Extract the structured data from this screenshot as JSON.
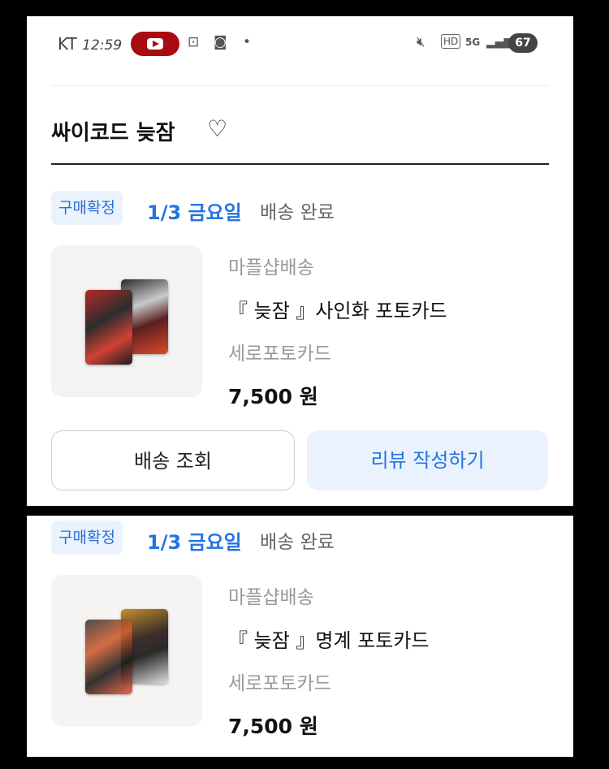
{
  "status_bar": {
    "carrier": "KT",
    "time": "12:59",
    "battery": "67",
    "network_hd": "HD",
    "network_5g": "5G"
  },
  "shop": {
    "name": "싸이코드 늦잠"
  },
  "orders": [
    {
      "badge": "구매확정",
      "date": "1/3 금요일",
      "delivery_status": "배송 완료",
      "seller": "마플샵배송",
      "product_name": "『 늦잠 』사인화 포토카드",
      "option": "세로포토카드",
      "price": "7,500 원",
      "buttons": {
        "track": "배송 조회",
        "review": "리뷰 작성하기"
      }
    },
    {
      "badge": "구매확정",
      "date": "1/3 금요일",
      "delivery_status": "배송 완료",
      "seller": "마플샵배송",
      "product_name": "『 늦잠 』명계 포토카드",
      "option": "세로포토카드",
      "price": "7,500 원"
    }
  ],
  "colors": {
    "accent": "#2374e1",
    "badge_bg": "#eaf2fd",
    "youtube_red": "#a80b12"
  }
}
